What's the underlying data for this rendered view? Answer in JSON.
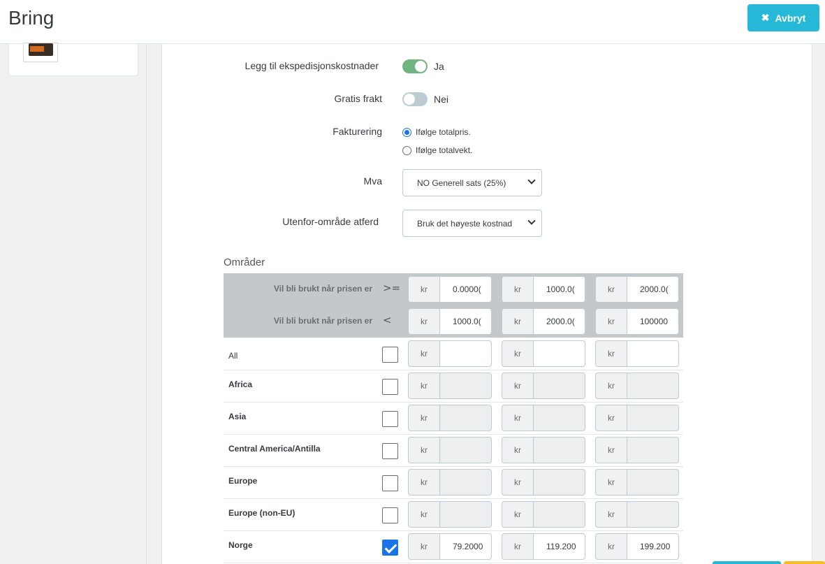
{
  "header": {
    "title": "Bring",
    "cancel_label": "Avbryt",
    "cancel_icon": "close-icon"
  },
  "form": {
    "handling_costs": {
      "label": "Legg til ekspedisjonskostnader",
      "state": "Ja"
    },
    "free_shipping": {
      "label": "Gratis frakt",
      "state": "Nei"
    },
    "billing": {
      "label": "Fakturering",
      "options": [
        "Ifølge totalpris.",
        "Ifølge totalvekt."
      ],
      "selected": "Ifølge totalpris."
    },
    "tax": {
      "label": "Mva",
      "value": "NO Generell sats (25%)"
    },
    "out_of_range": {
      "label": "Utenfor-område atferd",
      "value": "Bruk det høyeste kostnad"
    }
  },
  "zones": {
    "title": "Områder",
    "currency": "kr",
    "range_from": {
      "label": "Vil bli brukt når prisen er",
      "operator": ">=",
      "values": [
        "0.0000(",
        "1000.0(",
        "2000.0("
      ]
    },
    "range_to": {
      "label": "Vil bli brukt når prisen er",
      "operator": "<",
      "values": [
        "1000.0(",
        "2000.0(",
        "100000"
      ]
    },
    "rows": [
      {
        "name": "All",
        "checked": false,
        "values": [
          "",
          "",
          ""
        ]
      },
      {
        "name": "Africa",
        "checked": false,
        "values": [
          "",
          "",
          ""
        ]
      },
      {
        "name": "Asia",
        "checked": false,
        "values": [
          "",
          "",
          ""
        ]
      },
      {
        "name": "Central America/Antilla",
        "checked": false,
        "values": [
          "",
          "",
          ""
        ]
      },
      {
        "name": "Europe",
        "checked": false,
        "values": [
          "",
          "",
          ""
        ]
      },
      {
        "name": "Europe (non-EU)",
        "checked": false,
        "values": [
          "",
          "",
          ""
        ]
      },
      {
        "name": "Norge",
        "checked": true,
        "values": [
          "79.2000",
          "119.200",
          "199.200"
        ]
      }
    ]
  },
  "colors": {
    "accent": "#25b9d7",
    "switch_on": "#70b580",
    "switch_off": "#bbcdd2",
    "checkbox_checked": "#1a73e8"
  }
}
